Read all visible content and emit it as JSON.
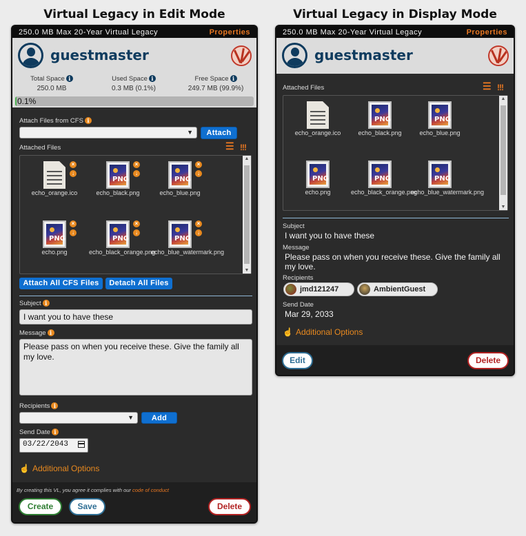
{
  "captions": {
    "edit": "Virtual Legacy in Edit Mode",
    "display": "Virtual Legacy in Display Mode"
  },
  "topbar": {
    "title": "250.0 MB Max 20-Year Virtual Legacy",
    "properties": "Properties"
  },
  "user": {
    "name": "guestmaster"
  },
  "space": {
    "total_label": "Total Space",
    "total_value": "250.0 MB",
    "used_label": "Used Space",
    "used_value": "0.3 MB (0.1%)",
    "free_label": "Free Space",
    "free_value": "249.7 MB (99.9%)",
    "progress_text": "0.1%",
    "progress_fraction": 0.001
  },
  "attach": {
    "label": "Attach Files from CFS",
    "button": "Attach"
  },
  "attached_files": {
    "label": "Attached Files",
    "files": [
      {
        "name": "echo_orange.ico",
        "kind": "doc"
      },
      {
        "name": "echo_black.png",
        "kind": "png"
      },
      {
        "name": "echo_blue.png",
        "kind": "png"
      },
      {
        "name": "echo.png",
        "kind": "png"
      },
      {
        "name": "echo_black_orange.png",
        "kind": "png"
      },
      {
        "name": "echo_blue_watermark.png",
        "kind": "png"
      }
    ],
    "attach_all": "Attach All CFS Files",
    "detach_all": "Detach All Files"
  },
  "form": {
    "subject_label": "Subject",
    "subject_value": "I want you to have these",
    "message_label": "Message",
    "message_value": "Please pass on when you receive these. Give the family all my love.",
    "recipients_label": "Recipients",
    "add_button": "Add",
    "send_date_label": "Send Date",
    "send_date_value": "03/22/2043",
    "additional_options": "Additional Options"
  },
  "footer": {
    "note": "By creating this VL, you agree it complies with our",
    "link": "code of conduct",
    "create": "Create",
    "save": "Save",
    "delete": "Delete"
  },
  "display": {
    "subject_value": "I want you to have these",
    "message_value": "Please pass on when you receive these. Give the family all my love.",
    "recipients": [
      "jmd121247",
      "AmbientGuest"
    ],
    "send_date_value": "Mar 29, 2033",
    "edit": "Edit",
    "delete": "Delete"
  },
  "colors": {
    "accent": "#e87722",
    "primary_blue": "#0f6fd0",
    "navy": "#0f3b5e",
    "panel_bg": "#2b2b2b"
  },
  "icons": [
    "user-avatar-icon",
    "legacy-seal-icon",
    "info-icon",
    "list-view-icon",
    "priority-icon",
    "remove-file-icon",
    "download-file-icon",
    "png-file-icon",
    "document-file-icon",
    "calendar-icon",
    "hand-pointer-icon"
  ]
}
